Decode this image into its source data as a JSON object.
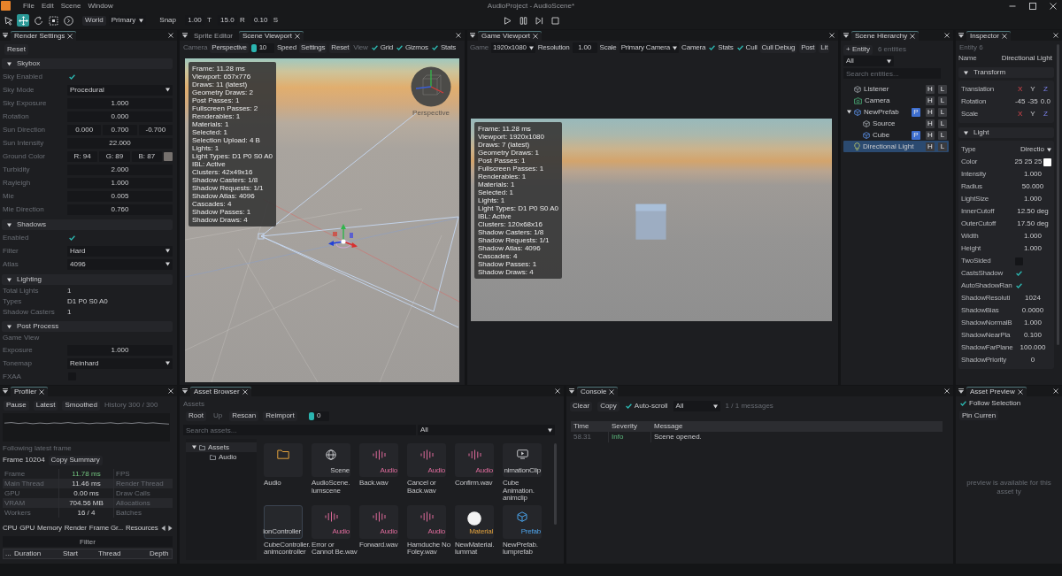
{
  "menu_bar": {
    "menus": [
      "File",
      "Edit",
      "Scene",
      "Window"
    ],
    "title": "AudioProject - AudioScene*"
  },
  "toolbar": {
    "tools": [
      {
        "kind": "select",
        "selected": false
      },
      {
        "kind": "move",
        "selected": true
      },
      {
        "kind": "rotate",
        "selected": false
      },
      {
        "kind": "scale",
        "selected": false
      },
      {
        "kind": "transform",
        "selected": false
      }
    ],
    "space": "World",
    "pivot": "Primary",
    "snap_label": "Snap",
    "snaps": [
      {
        "value": "1.00",
        "unit": "T"
      },
      {
        "value": "15.0",
        "unit": "R"
      },
      {
        "value": "0.10",
        "unit": "S"
      }
    ],
    "playback": [
      {
        "kind": "play"
      },
      {
        "kind": "pause"
      },
      {
        "kind": "step"
      },
      {
        "kind": "stop"
      }
    ]
  },
  "render_settings": {
    "tabs": [
      {
        "label": "Render Settings",
        "selected": true
      }
    ],
    "reset": "Reset",
    "sections": [
      {
        "title": "Skybox",
        "expanded": true,
        "rows": [
          {
            "kind": "check",
            "label": "Sky Enabled",
            "checked": true
          },
          {
            "kind": "dropdown",
            "label": "Sky Mode",
            "value": "Procedural"
          },
          {
            "kind": "number",
            "label": "Sky Exposure",
            "value": "1.000"
          },
          {
            "kind": "number",
            "label": "Rotation",
            "value": "0.000"
          },
          {
            "kind": "vector",
            "label": "Sun Direction",
            "values": [
              "0.000",
              "0.700",
              "-0.700"
            ]
          },
          {
            "kind": "number",
            "label": "Sun Intensity",
            "value": "22.000"
          },
          {
            "kind": "color",
            "label": "Ground Color",
            "values": [
              "R: 94",
              "G: 89",
              "B: 87"
            ],
            "color": "#76716e"
          },
          {
            "kind": "number",
            "label": "Turbidity",
            "value": "2.000"
          },
          {
            "kind": "number",
            "label": "Rayleigh",
            "value": "1.000"
          },
          {
            "kind": "number",
            "label": "Mie",
            "value": "0.005"
          },
          {
            "kind": "number",
            "label": "Mie Direction",
            "value": "0.760"
          }
        ]
      },
      {
        "title": "Shadows",
        "expanded": true,
        "rows": [
          {
            "kind": "check",
            "label": "Enabled",
            "checked": true
          },
          {
            "kind": "dropdown",
            "label": "Filter",
            "value": "Hard"
          },
          {
            "kind": "dropdown",
            "label": "Atlas",
            "value": "4096"
          }
        ]
      },
      {
        "title": "Lighting",
        "expanded": true,
        "rows": [
          {
            "kind": "text",
            "label": "Total Lights",
            "value": "1"
          },
          {
            "kind": "text",
            "label": "Types",
            "value": "D1 P0 S0 A0"
          },
          {
            "kind": "text",
            "label": "Shadow Casters",
            "value": "1"
          }
        ]
      },
      {
        "title": "Post Process",
        "expanded": true,
        "rows": [
          {
            "kind": "heading",
            "label": "Game View"
          },
          {
            "kind": "number",
            "label": "Exposure",
            "value": "1.000"
          },
          {
            "kind": "dropdown",
            "label": "Tonemap",
            "value": "Reinhard"
          },
          {
            "kind": "check",
            "label": "FXAA",
            "checked": false
          }
        ]
      }
    ]
  },
  "scene_view": {
    "tabs": [
      {
        "label": "Sprite Editor",
        "selected": false
      },
      {
        "label": "Scene Viewport",
        "selected": true
      }
    ],
    "toolbar": [
      {
        "kind": "label",
        "text": "Camera"
      },
      {
        "kind": "button",
        "text": "Perspective"
      },
      {
        "kind": "slider",
        "text": "10",
        "level": 0
      },
      {
        "kind": "caption",
        "text": "Speed"
      },
      {
        "kind": "button",
        "text": "Settings"
      },
      {
        "kind": "button",
        "text": "Reset"
      },
      {
        "kind": "label",
        "text": "View"
      },
      {
        "kind": "check",
        "text": "Grid",
        "checked": true
      },
      {
        "kind": "check",
        "text": "Gizmos",
        "checked": true
      },
      {
        "kind": "check",
        "text": "Stats",
        "checked": true
      }
    ],
    "stats": [
      "Frame: 11.28 ms",
      "Viewport: 657x776",
      "Draws: 11 (latest)",
      "Geometry Draws: 2",
      "Post Passes: 1",
      "Fullscreen Passes: 2",
      "Renderables: 1",
      "Materials: 1",
      "Selected: 1",
      "Selection Upload: 4 B",
      "Lights: 1",
      "Light Types: D1 P0 S0 A0",
      "IBL: Active",
      "Clusters: 42x49x16",
      "Shadow Casters: 1/8",
      "Shadow Requests: 1/1",
      "Shadow Atlas: 4096",
      "Cascades: 4",
      "Shadow Passes: 1",
      "Shadow Draws: 4"
    ],
    "gizmo_label": "Perspective"
  },
  "game_view": {
    "tabs": [
      {
        "label": "Game Viewport",
        "selected": true
      }
    ],
    "toolbar": [
      {
        "kind": "label",
        "text": "Game"
      },
      {
        "kind": "dropdown",
        "text": "1920x1080"
      },
      {
        "kind": "caption",
        "text": "Resolution"
      },
      {
        "kind": "field",
        "text": "1.00"
      },
      {
        "kind": "caption",
        "text": "Scale"
      },
      {
        "kind": "dropdown",
        "text": "Primary Camera"
      },
      {
        "kind": "caption",
        "text": "Camera"
      },
      {
        "kind": "check",
        "text": "Stats",
        "checked": true
      },
      {
        "kind": "check",
        "text": "Cull",
        "checked": true
      },
      {
        "kind": "button",
        "text": "Cull Debug"
      },
      {
        "kind": "button",
        "text": "Post"
      },
      {
        "kind": "button",
        "text": "Lit"
      }
    ],
    "stats": [
      "Frame: 11.28 ms",
      "Viewport: 1920x1080",
      "Draws: 7 (latest)",
      "Geometry Draws: 1",
      "Post Passes: 1",
      "Fullscreen Passes: 1",
      "Renderables: 1",
      "Materials: 1",
      "Selected: 1",
      "Lights: 1",
      "Light Types: D1 P0 S0 A0",
      "IBL: Active",
      "Clusters: 120x68x16",
      "Shadow Casters: 1/8",
      "Shadow Requests: 1/1",
      "Shadow Atlas: 4096",
      "Cascades: 4",
      "Shadow Passes: 1",
      "Shadow Draws: 4"
    ]
  },
  "hierarchy": {
    "tabs": [
      {
        "label": "Scene Hierarchy",
        "selected": true
      }
    ],
    "add_button": "+ Entity",
    "count": "6 entities",
    "filter": "All",
    "search": {
      "placeholder": "Search entities..."
    },
    "items": [
      {
        "name": "Listener",
        "kind": "entity",
        "selected": false,
        "badges": [
          "H",
          "L"
        ]
      },
      {
        "name": "Camera",
        "kind": "camera",
        "selected": false,
        "badges": [
          "H",
          "L"
        ]
      },
      {
        "name": "NewPrefab",
        "kind": "prefab",
        "selected": false,
        "expanded": true,
        "prefab_badge": "P",
        "badges": [
          "H",
          "L"
        ],
        "children": [
          {
            "name": "Source",
            "kind": "entity",
            "selected": false,
            "badges": [
              "H",
              "L"
            ]
          },
          {
            "name": "Cube",
            "kind": "prefab",
            "selected": false,
            "prefab_badge": "P",
            "badges": [
              "H",
              "L"
            ]
          }
        ]
      },
      {
        "name": "Directional Light",
        "kind": "light",
        "selected": true,
        "badges": [
          "H",
          "L"
        ]
      }
    ]
  },
  "inspector": {
    "tabs": [
      {
        "label": "Inspector",
        "selected": true
      }
    ],
    "entity": "Entity 6",
    "name_label": "Name",
    "name_value": "Directional Light",
    "sections": [
      {
        "title": "Transform",
        "expanded": true,
        "rows": [
          {
            "kind": "axes",
            "label": "Translation",
            "values": [
              "X",
              "Y",
              "Z"
            ]
          },
          {
            "kind": "vector",
            "label": "Rotation",
            "values": [
              "-45",
              "-35",
              "0.0"
            ]
          },
          {
            "kind": "axes",
            "label": "Scale",
            "values": [
              "X",
              "Y",
              "Z"
            ]
          }
        ]
      },
      {
        "title": "Light",
        "expanded": true,
        "rows": [
          {
            "kind": "dropdown",
            "label": "Type",
            "value": "Directio"
          },
          {
            "kind": "color",
            "label": "Color",
            "values": [
              "25",
              "25",
              "25"
            ],
            "color": "#ffffff"
          },
          {
            "kind": "number",
            "label": "Intensity",
            "value": "1.000"
          },
          {
            "kind": "number",
            "label": "Radius",
            "value": "50.000"
          },
          {
            "kind": "number",
            "label": "LightSize",
            "value": "1.000"
          },
          {
            "kind": "number",
            "label": "InnerCutoff",
            "value": "12.50 deg"
          },
          {
            "kind": "number",
            "label": "OuterCutoff",
            "value": "17.50 deg"
          },
          {
            "kind": "number",
            "label": "Width",
            "value": "1.000"
          },
          {
            "kind": "number",
            "label": "Height",
            "value": "1.000"
          },
          {
            "kind": "check",
            "label": "TwoSided",
            "checked": false
          },
          {
            "kind": "check",
            "label": "CastsShadow",
            "checked": true
          },
          {
            "kind": "check",
            "label": "AutoShadowRan",
            "checked": true
          },
          {
            "kind": "number",
            "label": "ShadowResoluti",
            "value": "1024"
          },
          {
            "kind": "number",
            "label": "ShadowBias",
            "value": "0.0000"
          },
          {
            "kind": "number",
            "label": "ShadowNormalB",
            "value": "1.000"
          },
          {
            "kind": "number",
            "label": "ShadowNearPla",
            "value": "0.100"
          },
          {
            "kind": "number",
            "label": "ShadowFarPlane",
            "value": "100.000"
          },
          {
            "kind": "number",
            "label": "ShadowPriority",
            "value": "0"
          }
        ]
      }
    ]
  },
  "profiler": {
    "tabs": [
      {
        "label": "Profiler",
        "selected": true
      }
    ],
    "toolbar": [
      {
        "kind": "button",
        "text": "Pause"
      },
      {
        "kind": "button",
        "text": "Latest"
      },
      {
        "kind": "button",
        "text": "Smoothed"
      },
      {
        "kind": "label",
        "text": "History 300 / 300"
      }
    ],
    "status": "Following latest frame",
    "frame": "Frame 10204",
    "copy_button": "Copy Summary",
    "stats": [
      {
        "label": "Frame",
        "value": "11.78 ms",
        "highlighted": true,
        "label_2": "FPS"
      },
      {
        "label": "Main Thread",
        "value": "11.46 ms",
        "highlighted": false,
        "label_2": "Render Thread"
      },
      {
        "label": "GPU",
        "value": "0.00 ms",
        "highlighted": false,
        "label_2": "Draw Calls"
      },
      {
        "label": "VRAM",
        "value": "704.56 MB",
        "highlighted": false,
        "label_2": "Allocations"
      },
      {
        "label": "Workers",
        "value": "16 / 4",
        "highlighted": false,
        "label_2": "Batches"
      }
    ],
    "views": [
      "CPU",
      "GPU",
      "Memory",
      "Render",
      "Frame Gr...",
      "Resources"
    ],
    "filter": {
      "placeholder": "Filter"
    },
    "columns": [
      "...",
      "Duration",
      "Start",
      "Thread",
      "Depth"
    ]
  },
  "asset_browser": {
    "tabs": [
      {
        "label": "Asset Browser",
        "selected": true
      }
    ],
    "section_label": "Assets",
    "toolbar": [
      {
        "kind": "button",
        "text": "Root",
        "disabled": false
      },
      {
        "kind": "button",
        "text": "Up",
        "disabled": true
      },
      {
        "kind": "button",
        "text": "Rescan",
        "disabled": false
      },
      {
        "kind": "button",
        "text": "Reimport",
        "disabled": false
      },
      {
        "kind": "slider",
        "text": "0",
        "level": 0
      }
    ],
    "search": {
      "placeholder": "Search assets..."
    },
    "filter": "All",
    "folders": [
      {
        "name": "Assets",
        "selected": true,
        "expanded": true,
        "children": [
          {
            "name": "Audio",
            "selected": false
          }
        ]
      }
    ],
    "assets": [
      {
        "kind": "folder",
        "name": "Audio",
        "selected": false
      },
      {
        "kind": "scene",
        "type": "Scene",
        "name": "AudioScene.lumscene",
        "selected": false
      },
      {
        "kind": "audio",
        "type": "Audio",
        "name": "Back.wav",
        "selected": false
      },
      {
        "kind": "audio",
        "type": "Audio",
        "name": "Cancel or Back.wav",
        "selected": false
      },
      {
        "kind": "audio",
        "type": "Audio",
        "name": "Confirm.wav",
        "selected": false
      },
      {
        "kind": "clip",
        "type": "nimationClip",
        "name": "Cube Animation.animclip",
        "selected": false
      },
      {
        "kind": "controller",
        "type": "ionController",
        "name": "CubeController.animcontroller",
        "selected": true
      },
      {
        "kind": "audio",
        "type": "Audio",
        "name": "Error or Cannot Be.wav",
        "selected": false
      },
      {
        "kind": "audio",
        "type": "Audio",
        "name": "Forward.wav",
        "selected": false
      },
      {
        "kind": "audio",
        "type": "Audio",
        "name": "Hamduche No Foley.wav",
        "selected": false
      },
      {
        "kind": "material",
        "type": "Material",
        "name": "NewMaterial.lummat",
        "selected": false
      },
      {
        "kind": "prefab",
        "type": "Prefab",
        "name": "NewPrefab.lumprefab",
        "selected": false
      }
    ]
  },
  "console": {
    "tabs": [
      {
        "label": "Console",
        "selected": true
      }
    ],
    "toolbar": [
      {
        "kind": "button",
        "text": "Clear"
      },
      {
        "kind": "button",
        "text": "Copy"
      },
      {
        "kind": "check",
        "text": "Auto-scroll",
        "checked": true
      },
      {
        "kind": "dropdown",
        "text": "All"
      },
      {
        "kind": "label",
        "text": "1 / 1 messages"
      }
    ],
    "columns": [
      "Time",
      "Severity",
      "Message"
    ],
    "rows": [
      {
        "time": "58.31",
        "severity": "Info",
        "message": "Scene opened.",
        "kind": "info"
      }
    ]
  },
  "asset_preview": {
    "tabs": [
      {
        "label": "Asset Preview",
        "selected": true
      }
    ],
    "toolbar": [
      {
        "kind": "check",
        "text": "Follow Selection",
        "checked": true
      },
      {
        "kind": "button",
        "text": "Pin Curren"
      }
    ],
    "message": "preview is available for this asset ty"
  }
}
